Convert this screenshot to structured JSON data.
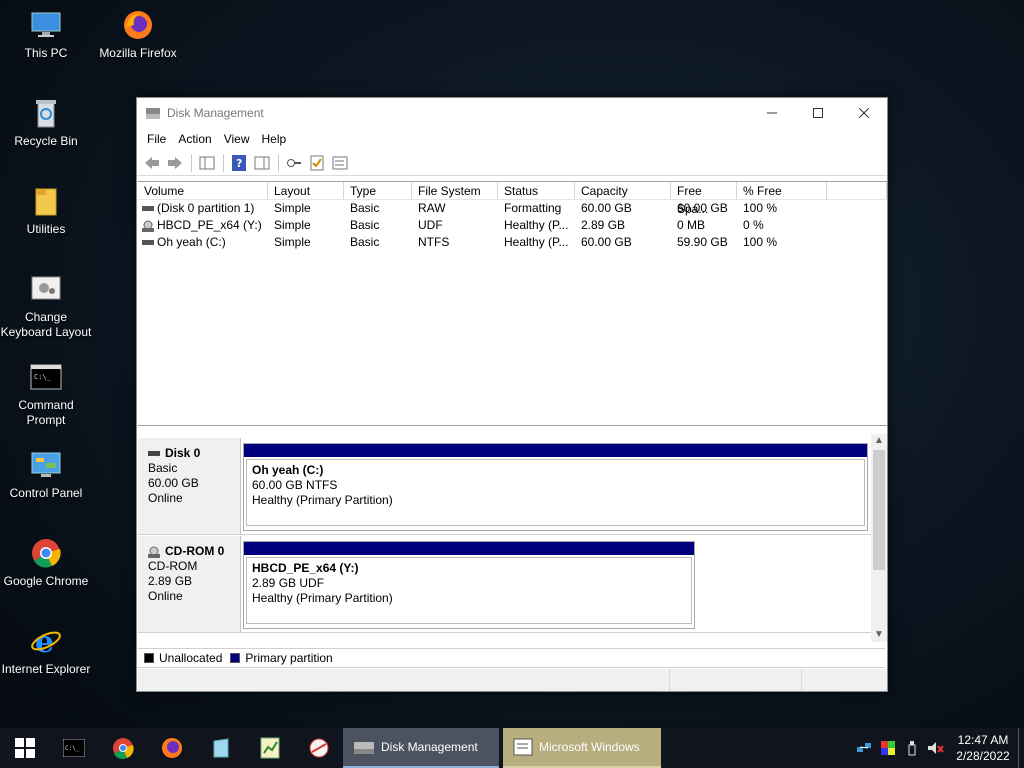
{
  "desktop": {
    "icons": [
      {
        "label": "This PC"
      },
      {
        "label": "Mozilla Firefox"
      },
      {
        "label": "Recycle Bin"
      },
      {
        "label": "Utilities"
      },
      {
        "label": "Change Keyboard Layout"
      },
      {
        "label": "Command Prompt"
      },
      {
        "label": "Control Panel"
      },
      {
        "label": "Google Chrome"
      },
      {
        "label": "Internet Explorer"
      }
    ]
  },
  "window": {
    "title": "Disk Management",
    "menu": [
      "File",
      "Action",
      "View",
      "Help"
    ],
    "columns": [
      "Volume",
      "Layout",
      "Type",
      "File System",
      "Status",
      "Capacity",
      "Free Spa...",
      "% Free"
    ],
    "volumes": [
      {
        "volume": "(Disk 0 partition 1)",
        "layout": "Simple",
        "type": "Basic",
        "fs": "RAW",
        "status": "Formatting",
        "capacity": "60.00 GB",
        "free": "60.00 GB",
        "pct": "100 %"
      },
      {
        "volume": "HBCD_PE_x64 (Y:)",
        "layout": "Simple",
        "type": "Basic",
        "fs": "UDF",
        "status": "Healthy (P...",
        "capacity": "2.89 GB",
        "free": "0 MB",
        "pct": "0 %"
      },
      {
        "volume": "Oh yeah (C:)",
        "layout": "Simple",
        "type": "Basic",
        "fs": "NTFS",
        "status": "Healthy (P...",
        "capacity": "60.00 GB",
        "free": "59.90 GB",
        "pct": "100 %"
      }
    ],
    "disks": [
      {
        "name": "Disk 0",
        "kind": "Basic",
        "size": "60.00 GB",
        "state": "Online",
        "part_title": "Oh yeah  (C:)",
        "part_size": "60.00 GB NTFS",
        "part_status": "Healthy (Primary Partition)"
      },
      {
        "name": "CD-ROM 0",
        "kind": "CD-ROM",
        "size": "2.89 GB",
        "state": "Online",
        "part_title": "HBCD_PE_x64  (Y:)",
        "part_size": "2.89 GB UDF",
        "part_status": "Healthy (Primary Partition)"
      }
    ],
    "legend": {
      "unallocated": "Unallocated",
      "primary": "Primary partition"
    },
    "colors": {
      "unallocated": "#000000",
      "primary": "#00007f"
    }
  },
  "taskbar": {
    "apps": [
      {
        "label": "Disk Management"
      },
      {
        "label": "Microsoft Windows"
      }
    ],
    "time": "12:47 AM",
    "date": "2/28/2022"
  }
}
